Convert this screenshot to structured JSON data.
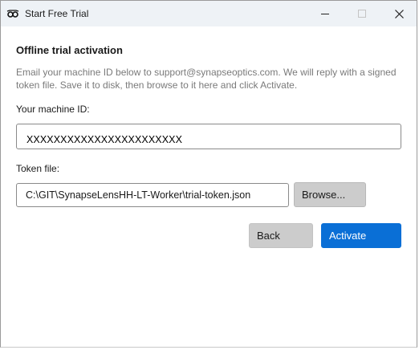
{
  "window": {
    "title": "Start Free Trial",
    "icon": "glasses-icon",
    "controls": [
      "minimize-icon",
      "maximize-icon",
      "close-icon"
    ]
  },
  "dialog": {
    "heading": "Offline trial activation",
    "instructions": "Email your machine ID below to support@synapseoptics.com. We will reply with a signed token file. Save it to disk, then browse to it here and click Activate.",
    "machine_id_label": "Your machine ID:",
    "machine_id_value": "XXXXXXXXXXXXXXXXXXXXXXX",
    "token_label": "Token file:",
    "token_value": "C:\\GIT\\SynapseLensHH-LT-Worker\\trial-token.json",
    "browse_label": "Browse...",
    "back_label": "Back",
    "activate_label": "Activate"
  },
  "colors": {
    "titlebar": "#eef2f6",
    "accent": "#0a6fd6",
    "secondary_button": "#cccccc",
    "muted_text": "#7a7a7a"
  }
}
